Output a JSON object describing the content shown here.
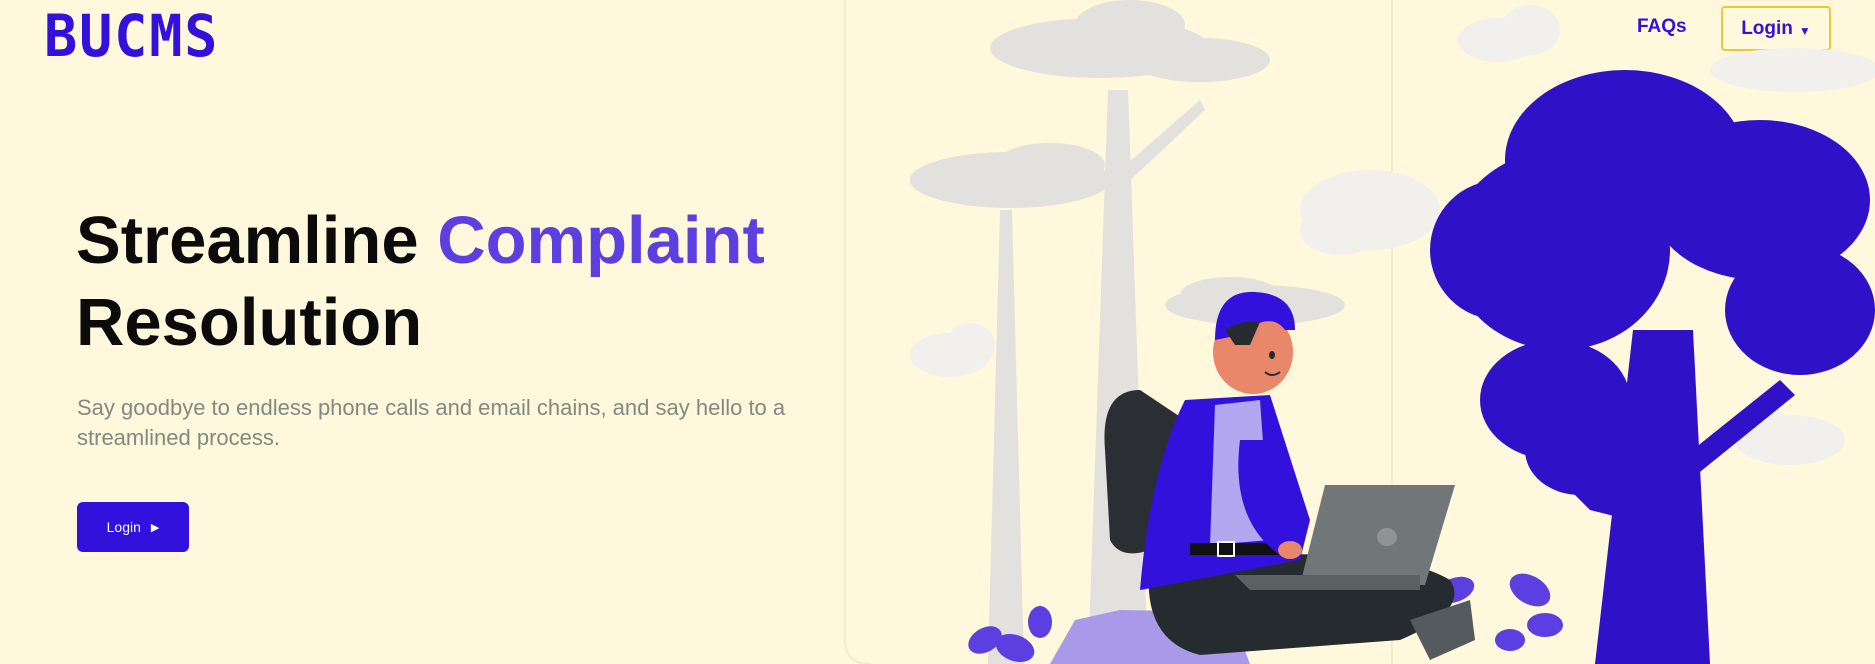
{
  "brand": {
    "name": "BUCMS"
  },
  "nav": {
    "faqs_label": "FAQs",
    "login_label": "Login"
  },
  "hero": {
    "title_part1": "Streamline ",
    "title_highlight": "Complaint",
    "title_part2": "Resolution",
    "subtitle": "Say goodbye to endless phone calls and email chains, and say hello to a streamlined process.",
    "cta_label": "Login"
  },
  "icons": {
    "login_caret": "caret-down-icon",
    "cta_arrow": "caret-right-icon"
  },
  "colors": {
    "background": "#fff8dc",
    "brand": "#3311dd",
    "accent": "#5b3fe0",
    "cta_bg": "#3311dd",
    "login_border": "#e6c93d",
    "subtext": "#808a7e",
    "tree": "#2f12c7"
  }
}
